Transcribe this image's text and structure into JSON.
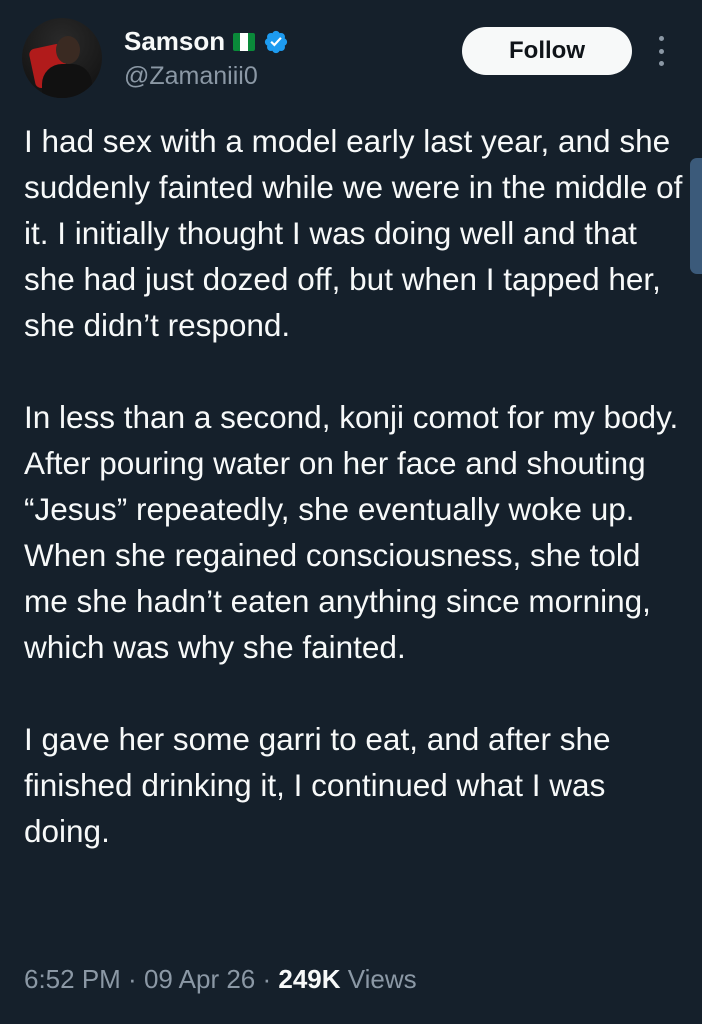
{
  "user": {
    "display_name": "Samson",
    "handle": "@Zamaniii0",
    "flag": "nigeria-flag",
    "verified": true
  },
  "follow_label": "Follow",
  "tweet": {
    "paragraphs": [
      "I had sex with a model early last year, and she suddenly fainted while we were in the middle of it. I initially thought I was doing well and that she had just dozed off, but when I tapped her, she didn’t respond.",
      "In less than a second, konji comot for my body. After pouring water on her face and shouting “Jesus” repeatedly, she eventually woke up. When she regained consciousness, she told me she hadn’t eaten anything since morning, which was why she fainted.",
      "I gave her some garri to eat, and after she finished drinking it, I continued what I was doing."
    ]
  },
  "meta": {
    "time": "6:52 PM",
    "separator": " · ",
    "date": "09 Apr 26",
    "views_count": "249K",
    "views_label": "Views"
  },
  "colors": {
    "background": "#15202b",
    "text": "#f7f9f9",
    "secondary": "#8b98a5",
    "verified": "#1d9bf0"
  }
}
